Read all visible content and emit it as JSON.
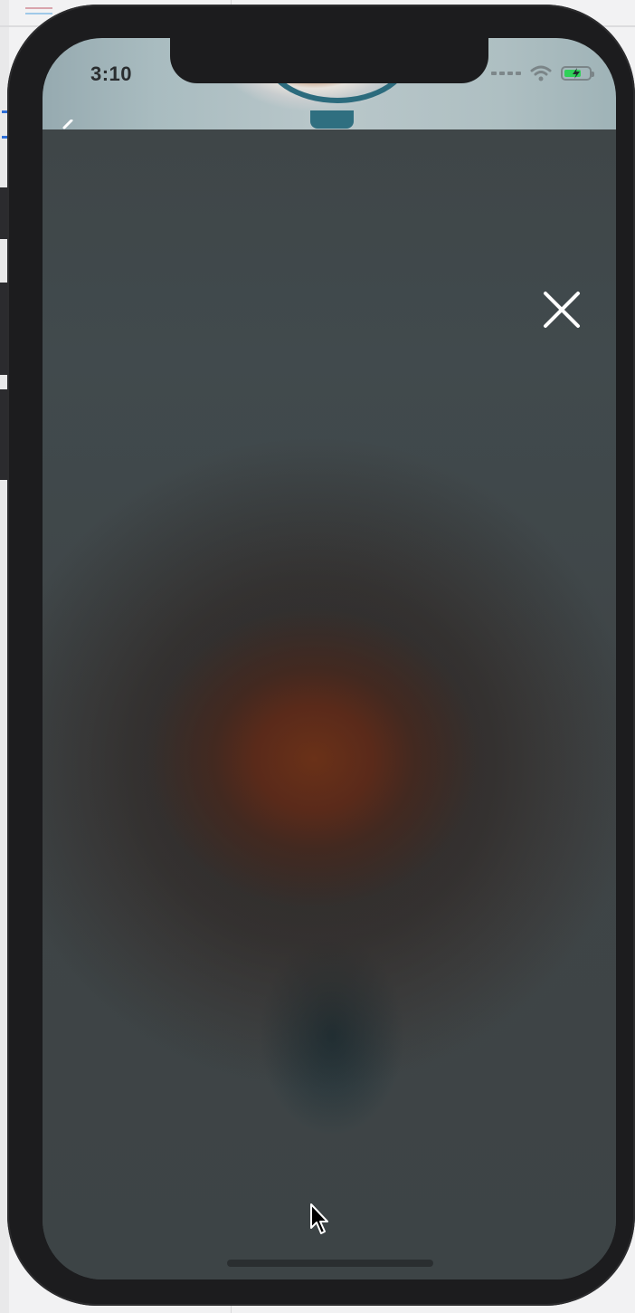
{
  "status_bar": {
    "time": "3:10"
  },
  "icons": {
    "close": "close-icon",
    "back": "chevron-left-icon",
    "wifi": "wifi-icon",
    "battery": "battery-charging-icon",
    "cellular": "cellular-signal-icon",
    "cursor": "mouse-pointer-icon"
  },
  "colors": {
    "battery_fill": "#2fd158",
    "overlay": "#3f4648",
    "frame": "#1c1c1e"
  }
}
